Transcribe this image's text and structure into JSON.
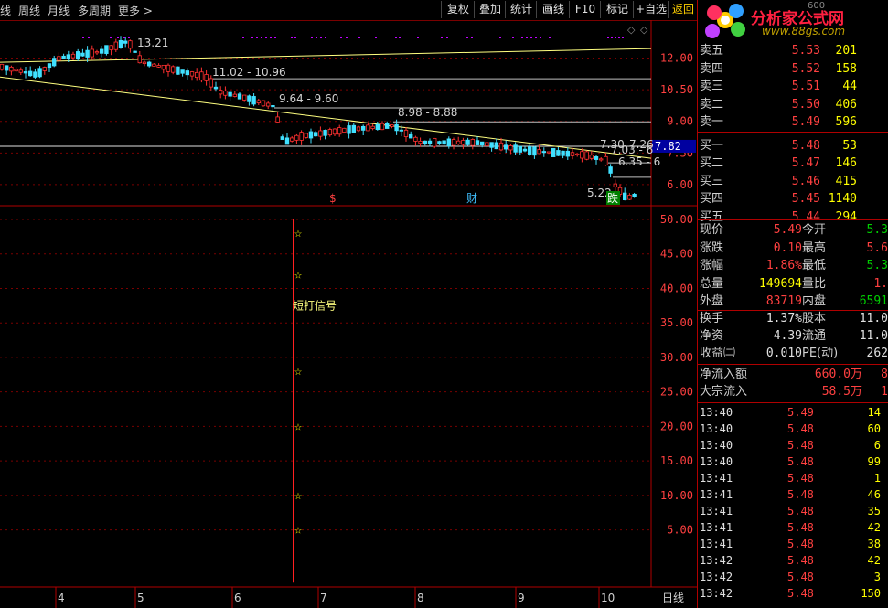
{
  "toolbar": {
    "left_items": [
      "线",
      "周线",
      "月线",
      "多周期",
      "更多"
    ],
    "right_buttons": [
      "复权",
      "叠加",
      "统计",
      "画线",
      "F10",
      "标记",
      "+自选",
      "返回"
    ]
  },
  "logo": {
    "title": "分析家公式网",
    "url": "www.88gs.com",
    "partial_code": "600"
  },
  "orderbook": {
    "asks": [
      {
        "label": "卖五",
        "price": "5.53",
        "vol": "201"
      },
      {
        "label": "卖四",
        "price": "5.52",
        "vol": "158"
      },
      {
        "label": "卖三",
        "price": "5.51",
        "vol": "44"
      },
      {
        "label": "卖二",
        "price": "5.50",
        "vol": "406"
      },
      {
        "label": "卖一",
        "price": "5.49",
        "vol": "596"
      }
    ],
    "bids": [
      {
        "label": "买一",
        "price": "5.48",
        "vol": "53"
      },
      {
        "label": "买二",
        "price": "5.47",
        "vol": "146"
      },
      {
        "label": "买三",
        "price": "5.46",
        "vol": "415"
      },
      {
        "label": "买四",
        "price": "5.45",
        "vol": "1140"
      },
      {
        "label": "买五",
        "price": "5.44",
        "vol": "294"
      }
    ]
  },
  "quote": {
    "rows": [
      {
        "l1": "现价",
        "v1": "5.49",
        "c1": "#ff4040",
        "l2": "今开",
        "v2": "5.3",
        "c2": "#00d000"
      },
      {
        "l1": "涨跌",
        "v1": "0.10",
        "c1": "#ff4040",
        "l2": "最高",
        "v2": "5.6",
        "c2": "#ff4040"
      },
      {
        "l1": "涨幅",
        "v1": "1.86%",
        "c1": "#ff4040",
        "l2": "最低",
        "v2": "5.3",
        "c2": "#00d000"
      },
      {
        "l1": "总量",
        "v1": "149694",
        "c1": "#ffff00",
        "l2": "量比",
        "v2": "1.",
        "c2": "#ff4040"
      },
      {
        "l1": "外盘",
        "v1": "83719",
        "c1": "#ff4040",
        "l2": "内盘",
        "v2": "6591",
        "c2": "#00d000"
      }
    ],
    "rows2": [
      {
        "l1": "换手",
        "v1": "1.37%",
        "c1": "#e0e0e0",
        "l2": "股本",
        "v2": "11.0",
        "c2": "#e0e0e0"
      },
      {
        "l1": "净资",
        "v1": "4.39",
        "c1": "#e0e0e0",
        "l2": "流通",
        "v2": "11.0",
        "c2": "#e0e0e0"
      },
      {
        "l1": "收益㈡",
        "v1": "0.010",
        "c1": "#e0e0e0",
        "l2": "PE(动)",
        "v2": "262",
        "c2": "#e0e0e0"
      }
    ],
    "flows": [
      {
        "label": "净流入额",
        "value": "660.0万",
        "extra": "8"
      },
      {
        "label": "大宗流入",
        "value": "58.5万",
        "extra": "1"
      }
    ]
  },
  "trades": [
    {
      "time": "13:40",
      "price": "5.49",
      "vol": "14"
    },
    {
      "time": "13:40",
      "price": "5.48",
      "vol": "60"
    },
    {
      "time": "13:40",
      "price": "5.48",
      "vol": "6"
    },
    {
      "time": "13:40",
      "price": "5.48",
      "vol": "99"
    },
    {
      "time": "13:41",
      "price": "5.48",
      "vol": "1"
    },
    {
      "time": "13:41",
      "price": "5.48",
      "vol": "46"
    },
    {
      "time": "13:41",
      "price": "5.48",
      "vol": "35"
    },
    {
      "time": "13:41",
      "price": "5.48",
      "vol": "42"
    },
    {
      "time": "13:41",
      "price": "5.48",
      "vol": "38"
    },
    {
      "time": "13:42",
      "price": "5.48",
      "vol": "42"
    },
    {
      "time": "13:42",
      "price": "5.48",
      "vol": "3"
    },
    {
      "time": "13:42",
      "price": "5.48",
      "vol": "150"
    }
  ],
  "chart_data": {
    "type": "candlestick",
    "main": {
      "yticks": [
        "12.00",
        "10.50",
        "9.00",
        "7.50",
        "6.00"
      ],
      "ylim": [
        5.0,
        13.8
      ],
      "current_price_tag": "7.82",
      "annotations": [
        "13.21",
        "11.02 - 10.96",
        "9.64 - 9.60",
        "8.98 - 8.88",
        "7.30",
        "7.26",
        "7.03 - 6",
        "6.35 - 6",
        "5.22"
      ],
      "markers": [
        "$",
        "财",
        "跌"
      ],
      "colors": {
        "up": "#ff3030",
        "down": "#40e0ff",
        "trendline": "#ffff80",
        "level": "#c0c0c0",
        "signal_dots": "#c000ff"
      }
    },
    "indicator": {
      "yticks": [
        "50.00",
        "45.00",
        "40.00",
        "35.00",
        "30.00",
        "25.00",
        "20.00",
        "15.00",
        "10.00",
        "5.00"
      ],
      "ylim": [
        0,
        50
      ],
      "signal_label": "短打信号",
      "star_values": [
        48,
        42,
        28,
        20,
        10,
        5
      ],
      "colors": {
        "bar": "#ff2020",
        "star": "#ffff00",
        "label": "#ffff80"
      }
    },
    "x_labels": [
      "4",
      "5",
      "6",
      "7",
      "8",
      "9",
      "10"
    ],
    "period_label": "日线"
  }
}
